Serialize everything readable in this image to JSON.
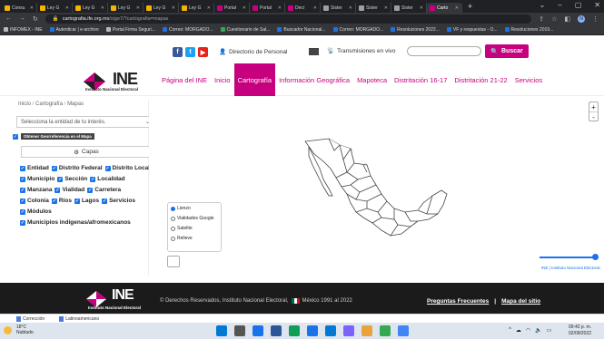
{
  "browser": {
    "tabs": [
      {
        "label": "Consu",
        "color": "#f4b400",
        "active": false
      },
      {
        "label": "Ley G",
        "color": "#f4b400",
        "active": false
      },
      {
        "label": "Ley G",
        "color": "#f4b400",
        "active": false
      },
      {
        "label": "Ley G",
        "color": "#f4b400",
        "active": false
      },
      {
        "label": "Ley G",
        "color": "#f4b400",
        "active": false
      },
      {
        "label": "Ley G",
        "color": "#f4b400",
        "active": false
      },
      {
        "label": "Portal",
        "color": "#c6007e",
        "active": false
      },
      {
        "label": "Portal",
        "color": "#c6007e",
        "active": false
      },
      {
        "label": "Decr",
        "color": "#c6007e",
        "active": false
      },
      {
        "label": "Sister",
        "color": "#9aa0a6",
        "active": false
      },
      {
        "label": "Sister",
        "color": "#9aa0a6",
        "active": false
      },
      {
        "label": "Sister",
        "color": "#9aa0a6",
        "active": false
      },
      {
        "label": "Carto",
        "color": "#c6007e",
        "active": true
      }
    ],
    "url_host": "cartografia.ife.org.mx",
    "url_path": "/sige7/?cartografia=mapas",
    "bookmarks": [
      {
        "label": "INFOMEX - INE",
        "color": "#bbb"
      },
      {
        "label": "Autenticar | e-archivo",
        "color": "#1a73e8"
      },
      {
        "label": "Portal Firma Seguri...",
        "color": "#bbb"
      },
      {
        "label": "Correo: MORGADO...",
        "color": "#1a73e8"
      },
      {
        "label": "Cuestionario de Sal...",
        "color": "#34a853"
      },
      {
        "label": "Buscador Nacional...",
        "color": "#1a73e8"
      },
      {
        "label": "Correo: MORGADO...",
        "color": "#1a73e8"
      },
      {
        "label": "Resoluciones 2022...",
        "color": "#1a73e8"
      },
      {
        "label": "VF y respuestas - O...",
        "color": "#1a73e8"
      },
      {
        "label": "Resoluciones 2019...",
        "color": "#1a73e8"
      }
    ]
  },
  "header": {
    "directory": "Directorio de Personal",
    "broadcast": "Transmisiones en vivo",
    "search_placeholder": "",
    "search_button": "Buscar",
    "logo_word": "INE",
    "logo_sub": "Instituto Nacional Electoral",
    "nav": [
      {
        "label": "Página del INE",
        "active": false
      },
      {
        "label": "Inicio",
        "active": false
      },
      {
        "label": "Cartografía",
        "active": true
      },
      {
        "label": "Información Geográfica",
        "active": false
      },
      {
        "label": "Mapoteca",
        "active": false
      },
      {
        "label": "Distritación 16-17",
        "active": false
      },
      {
        "label": "Distritación 21-22",
        "active": false
      },
      {
        "label": "Servicios",
        "active": false
      }
    ]
  },
  "sidebar": {
    "breadcrumb": [
      "Inicio",
      "Cartografía",
      "Mapas"
    ],
    "entity_select": "Selecciona la entidad de tu interés.",
    "geo_badge": "Obtener Georreferencia en el Mapa",
    "layers_button": "Capas",
    "layer_rows": [
      [
        "Entidad",
        "Distrito Federal",
        "Distrito Local"
      ],
      [
        "Municipio",
        "Sección",
        "Localidad"
      ],
      [
        "Manzana",
        "Vialidad",
        "Carretera"
      ],
      [
        "Colonia",
        "Ríos",
        "Lagos",
        "Servicios"
      ],
      [
        "Módulos"
      ],
      [
        "Municipios indígenas/afromexicanos"
      ]
    ]
  },
  "map": {
    "zoom_in": "+",
    "zoom_out": "-",
    "basemaps": [
      {
        "label": "Lienzo",
        "selected": true
      },
      {
        "label": "Vialidades Google",
        "selected": false
      },
      {
        "label": "Satelite",
        "selected": false
      },
      {
        "label": "Relieve",
        "selected": false
      }
    ],
    "attribution": "INE | Instituto Nacional Electoral"
  },
  "footer": {
    "logo_word": "INE",
    "logo_sub": "Instituto Nacional Electoral",
    "copyright_a": "© Derechos Reservados, Instituto Nacional Electoral,",
    "copyright_b": "México 1991 al 2022",
    "faq": "Preguntas Frecuentes",
    "separator": "|",
    "sitemap": "Mapa del sitio"
  },
  "downloads": [
    "Corrección",
    "Latinoamericano"
  ],
  "taskbar": {
    "temperature": "18°C",
    "weather": "Nublado",
    "time": "09:42 p. m.",
    "date": "02/09/2022",
    "apps": [
      "#0078d4",
      "#555",
      "#1a73e8",
      "#2b579a",
      "#0f9d58",
      "#1a73e8",
      "#0078d4",
      "#7b61ff",
      "#e8a33d",
      "#34a853",
      "#4285f4"
    ]
  },
  "colors": {
    "brand": "#c6007e",
    "link": "#1a73e8"
  }
}
